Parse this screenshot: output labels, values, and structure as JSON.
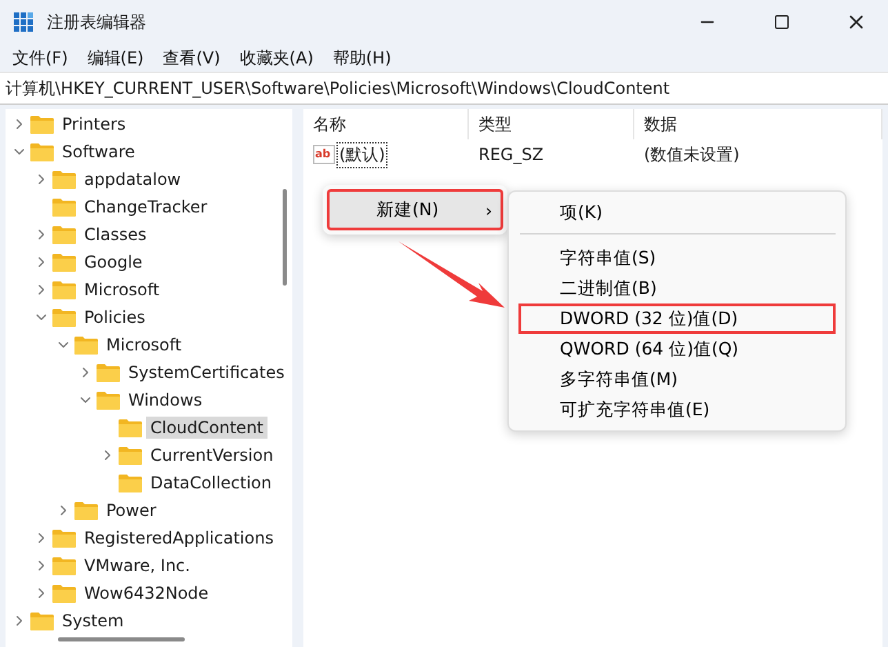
{
  "window": {
    "title": "注册表编辑器"
  },
  "menu_bar": [
    "文件(F)",
    "编辑(E)",
    "查看(V)",
    "收藏夹(A)",
    "帮助(H)"
  ],
  "address": "计算机\\HKEY_CURRENT_USER\\Software\\Policies\\Microsoft\\Windows\\CloudContent",
  "tree": [
    {
      "label": "Printers",
      "expanded": false,
      "selected": false
    },
    {
      "label": "Software",
      "expanded": true,
      "selected": false,
      "children": [
        {
          "label": "appdatalow",
          "expanded": false,
          "selected": false
        },
        {
          "label": "ChangeTracker",
          "selected": false
        },
        {
          "label": "Classes",
          "expanded": false,
          "selected": false
        },
        {
          "label": "Google",
          "expanded": false,
          "selected": false
        },
        {
          "label": "Microsoft",
          "expanded": false,
          "selected": false
        },
        {
          "label": "Policies",
          "expanded": true,
          "selected": false,
          "children": [
            {
              "label": "Microsoft",
              "expanded": true,
              "selected": false,
              "children": [
                {
                  "label": "SystemCertificates",
                  "expanded": false,
                  "selected": false
                },
                {
                  "label": "Windows",
                  "expanded": true,
                  "selected": false,
                  "children": [
                    {
                      "label": "CloudContent",
                      "selected": true
                    },
                    {
                      "label": "CurrentVersion",
                      "expanded": false,
                      "selected": false
                    },
                    {
                      "label": "DataCollection",
                      "selected": false
                    }
                  ]
                }
              ]
            },
            {
              "label": "Power",
              "expanded": false,
              "selected": false
            }
          ]
        },
        {
          "label": "RegisteredApplications",
          "expanded": false,
          "selected": false
        },
        {
          "label": "VMware, Inc.",
          "expanded": false,
          "selected": false
        },
        {
          "label": "Wow6432Node",
          "expanded": false,
          "selected": false
        }
      ]
    },
    {
      "label": "System",
      "expanded": false,
      "selected": false
    }
  ],
  "table": {
    "columns": [
      "名称",
      "类型",
      "数据"
    ],
    "rows": [
      {
        "icon": "ab",
        "name": "(默认)",
        "type": "REG_SZ",
        "data": "(数值未设置)"
      }
    ]
  },
  "context_menu": {
    "items": [
      {
        "label": "新建(N)",
        "arrow": "›",
        "selected": true,
        "highlighted": true
      }
    ]
  },
  "submenu": {
    "items": [
      {
        "label": "项(K)",
        "highlighted": false,
        "separator_after": true
      },
      {
        "label": "字符串值(S)",
        "highlighted": false,
        "separator_after": false
      },
      {
        "label": "二进制值(B)",
        "highlighted": false,
        "separator_after": false
      },
      {
        "label": "DWORD (32 位)值(D)",
        "highlighted": true,
        "separator_after": false
      },
      {
        "label": "QWORD (64 位)值(Q)",
        "highlighted": false,
        "separator_after": false
      },
      {
        "label": "多字符串值(M)",
        "highlighted": false,
        "separator_after": false
      },
      {
        "label": "可扩充字符串值(E)",
        "highlighted": false,
        "separator_after": false
      }
    ]
  }
}
